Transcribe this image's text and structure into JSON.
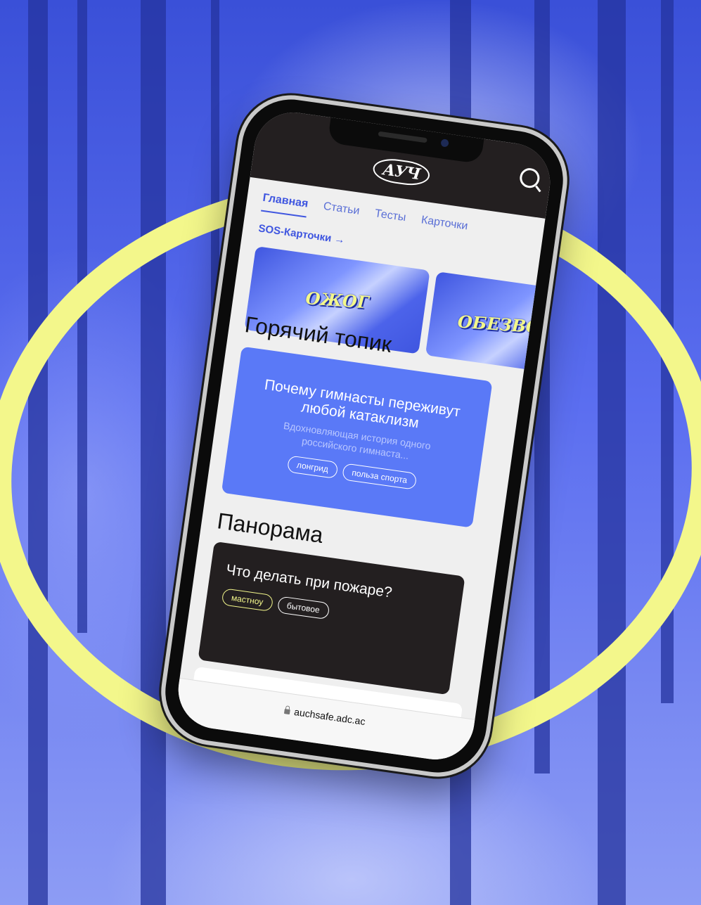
{
  "header": {
    "logo": "АУЧ"
  },
  "nav": {
    "tabs": [
      {
        "label": "Главная"
      },
      {
        "label": "Статьи"
      },
      {
        "label": "Тесты"
      },
      {
        "label": "Карточки"
      }
    ],
    "sos_link": "SOS-Карточки",
    "sos_arrow": "→"
  },
  "sos_cards": [
    {
      "label": "ОЖОГ"
    },
    {
      "label": "ОБЕЗВОЖИ"
    }
  ],
  "hot_topic": {
    "section_title": "Горячий топик",
    "title": "Почему гимнасты переживут любой катаклизм",
    "description": "Вдохновляющая история одного российского гимнаста...",
    "tags": [
      "лонгрид",
      "польза спорта"
    ]
  },
  "panorama": {
    "section_title": "Панорама",
    "title": "Что делать при пожаре?",
    "tags": [
      "мастноу",
      "бытовое"
    ]
  },
  "browser": {
    "url": "auchsafe.adc.ac"
  },
  "colors": {
    "accent": "#3f56e0",
    "highlight": "#f3f78b",
    "dark": "#231f20"
  }
}
